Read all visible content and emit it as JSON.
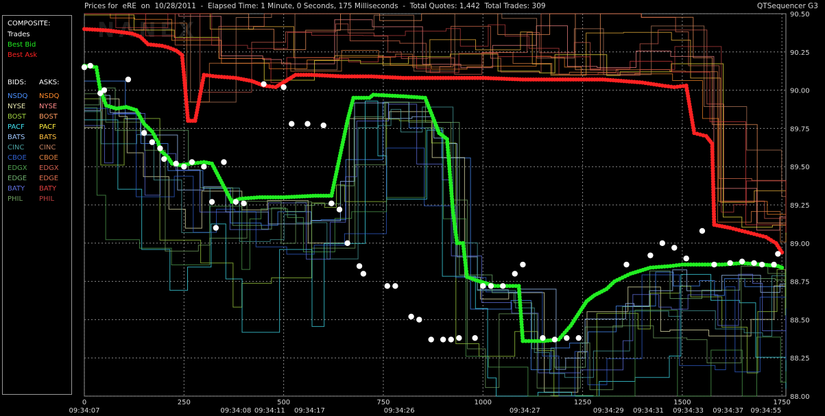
{
  "header": {
    "title": "Prices for  eRE  on  10/28/2011  -  Elapsed Time: 1 Minute, 0 Seconds, 175 Milliseconds  -  Total Quotes: 1,442  Total Trades: 309",
    "app_name": "QTSequencer G3",
    "watermark": "NANEX"
  },
  "legend": {
    "composite_title": "COMPOSITE:",
    "composite": [
      {
        "label": "Trades",
        "color": "#ffffff"
      },
      {
        "label": "Best Bid",
        "color": "#22ee22"
      },
      {
        "label": "Best Ask",
        "color": "#ff2222"
      }
    ],
    "bids_title": "BIDS:",
    "asks_title": "ASKS:",
    "exchanges": [
      {
        "bid": "NSDQ",
        "ask": "NSDQ",
        "bid_color": "#4a90ff",
        "ask_color": "#ff8a2a"
      },
      {
        "bid": "NYSE",
        "ask": "NYSE",
        "bid_color": "#e8e8b0",
        "ask_color": "#ff8a8a"
      },
      {
        "bid": "BOST",
        "ask": "BOST",
        "bid_color": "#a0d040",
        "ask_color": "#ff9a60"
      },
      {
        "bid": "PACF",
        "ask": "PACF",
        "bid_color": "#40e0f0",
        "ask_color": "#ffee40"
      },
      {
        "bid": "BATS",
        "ask": "BATS",
        "bid_color": "#a0c8ff",
        "ask_color": "#ffc040"
      },
      {
        "bid": "CINC",
        "ask": "CINC",
        "bid_color": "#4aa0a0",
        "ask_color": "#c08060"
      },
      {
        "bid": "CBOE",
        "ask": "CBOE",
        "bid_color": "#3060d0",
        "ask_color": "#e08040"
      },
      {
        "bid": "EDGX",
        "ask": "EDGX",
        "bid_color": "#50a050",
        "ask_color": "#d06050"
      },
      {
        "bid": "EDGE",
        "ask": "EDGE",
        "bid_color": "#70b070",
        "ask_color": "#e07050"
      },
      {
        "bid": "BATY",
        "ask": "BATY",
        "bid_color": "#6070e0",
        "ask_color": "#e04040"
      },
      {
        "bid": "PHIL",
        "ask": "PHIL",
        "bid_color": "#70a060",
        "ask_color": "#c04040"
      }
    ]
  },
  "chart_data": {
    "type": "line",
    "ylim": [
      88.0,
      90.5
    ],
    "xlim": [
      0,
      1760
    ],
    "y_ticks": [
      "88.00",
      "88.25",
      "88.50",
      "88.75",
      "89.00",
      "89.25",
      "89.50",
      "89.75",
      "90.00",
      "90.25",
      "90.50"
    ],
    "x_ticks": [
      {
        "value": 0,
        "label": "0"
      },
      {
        "value": 250,
        "label": "250"
      },
      {
        "value": 500,
        "label": "500"
      },
      {
        "value": 750,
        "label": "750"
      },
      {
        "value": 1000,
        "label": "1000"
      },
      {
        "value": 1250,
        "label": "1250"
      },
      {
        "value": 1500,
        "label": "1500"
      },
      {
        "value": 1750,
        "label": "1750"
      }
    ],
    "time_labels": [
      {
        "value": 0,
        "label": "09:34:07"
      },
      {
        "value": 380,
        "label": "09:34:08"
      },
      {
        "value": 465,
        "label": "09:34:11"
      },
      {
        "value": 565,
        "label": "09:34:17"
      },
      {
        "value": 790,
        "label": "09:34:26"
      },
      {
        "value": 1105,
        "label": "09:34:27"
      },
      {
        "value": 1315,
        "label": "09:34:29"
      },
      {
        "value": 1415,
        "label": "09:34:31"
      },
      {
        "value": 1515,
        "label": "09:34:33"
      },
      {
        "value": 1615,
        "label": "09:34:37"
      },
      {
        "value": 1710,
        "label": "09:34:55"
      }
    ],
    "grid": true,
    "series": [
      {
        "name": "Best Ask",
        "color": "#ff2222",
        "x": [
          0,
          60,
          120,
          140,
          160,
          195,
          210,
          230,
          245,
          250,
          260,
          278,
          300,
          330,
          380,
          420,
          450,
          480,
          530,
          570,
          650,
          720,
          800,
          900,
          1000,
          1100,
          1200,
          1300,
          1400,
          1450,
          1480,
          1510,
          1530,
          1560,
          1575,
          1580,
          1620,
          1650,
          1680,
          1710,
          1735,
          1750
        ],
        "y": [
          90.4,
          90.39,
          90.37,
          90.35,
          90.3,
          90.29,
          90.28,
          90.26,
          90.23,
          90.1,
          89.8,
          89.8,
          90.1,
          90.09,
          90.08,
          90.06,
          90.03,
          90.02,
          90.1,
          90.1,
          90.09,
          90.09,
          90.08,
          90.08,
          90.08,
          90.07,
          90.07,
          90.07,
          90.05,
          90.03,
          90.02,
          90.03,
          89.72,
          89.7,
          89.65,
          89.12,
          89.1,
          89.08,
          89.06,
          89.04,
          89.0,
          88.94
        ]
      },
      {
        "name": "Best Bid",
        "color": "#22ee22",
        "x": [
          0,
          30,
          40,
          55,
          80,
          105,
          130,
          150,
          170,
          185,
          190,
          210,
          220,
          240,
          270,
          300,
          320,
          370,
          390,
          440,
          500,
          580,
          620,
          660,
          675,
          715,
          725,
          800,
          855,
          890,
          900,
          910,
          925,
          935,
          950,
          960,
          980,
          1030,
          1060,
          1090,
          1100,
          1130,
          1150,
          1190,
          1200,
          1220,
          1250,
          1260,
          1280,
          1310,
          1330,
          1370,
          1420,
          1470,
          1500,
          1550,
          1600,
          1650,
          1700,
          1740,
          1750
        ],
        "y": [
          90.16,
          90.15,
          90.0,
          89.9,
          89.88,
          89.89,
          89.87,
          89.78,
          89.73,
          89.66,
          89.61,
          89.56,
          89.52,
          89.51,
          89.52,
          89.53,
          89.52,
          89.27,
          89.29,
          89.3,
          89.3,
          89.31,
          89.31,
          89.8,
          89.95,
          89.95,
          89.97,
          89.96,
          89.95,
          89.72,
          89.7,
          89.68,
          89.2,
          89.0,
          89.0,
          88.78,
          88.76,
          88.72,
          88.72,
          88.72,
          88.36,
          88.36,
          88.36,
          88.37,
          88.4,
          88.46,
          88.58,
          88.62,
          88.66,
          88.7,
          88.75,
          88.8,
          88.84,
          88.85,
          88.86,
          88.86,
          88.86,
          88.87,
          88.86,
          88.85,
          88.84
        ]
      },
      {
        "name": "Trades",
        "color": "#ffffff",
        "x": [
          0,
          15,
          40,
          50,
          110,
          150,
          170,
          190,
          200,
          230,
          250,
          270,
          300,
          320,
          330,
          350,
          380,
          400,
          450,
          500,
          520,
          560,
          600,
          620,
          640,
          660,
          690,
          700,
          760,
          780,
          820,
          840,
          870,
          900,
          920,
          940,
          980,
          1000,
          1020,
          1050,
          1080,
          1100,
          1150,
          1180,
          1210,
          1240,
          1360,
          1420,
          1450,
          1480,
          1510,
          1550,
          1580,
          1620,
          1650,
          1680,
          1700,
          1730,
          1740
        ],
        "y": [
          90.15,
          90.16,
          89.98,
          90.0,
          90.07,
          89.72,
          89.66,
          89.62,
          89.55,
          89.52,
          89.5,
          89.53,
          89.5,
          89.27,
          89.1,
          89.53,
          89.27,
          89.26,
          90.04,
          90.02,
          89.78,
          89.78,
          89.77,
          89.26,
          89.22,
          89.0,
          88.85,
          88.8,
          88.72,
          88.72,
          88.52,
          88.5,
          88.37,
          88.37,
          88.37,
          88.38,
          88.38,
          88.72,
          88.72,
          88.72,
          88.8,
          88.86,
          88.38,
          88.37,
          88.38,
          88.38,
          88.86,
          88.92,
          89.0,
          88.97,
          88.9,
          89.08,
          88.86,
          88.87,
          88.88,
          88.87,
          88.86,
          88.86,
          88.93
        ]
      }
    ]
  }
}
